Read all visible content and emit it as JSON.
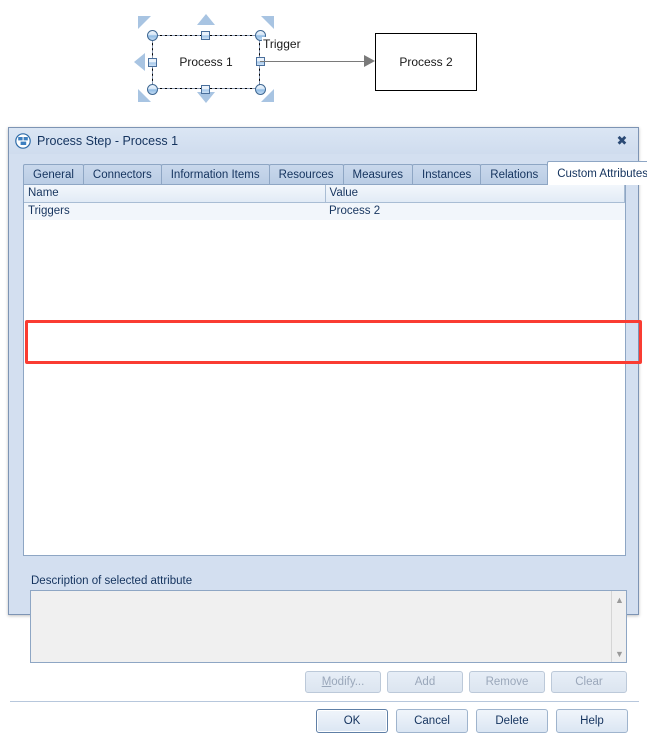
{
  "diagram": {
    "shape1_label": "Process 1",
    "shape2_label": "Process 2",
    "connector_label": "Trigger"
  },
  "dialog": {
    "title": "Process Step - Process 1",
    "icon": "process-step-icon",
    "close_label": "✖",
    "tabs": [
      {
        "label": "General",
        "active": false
      },
      {
        "label": "Connectors",
        "active": false
      },
      {
        "label": "Information Items",
        "active": false
      },
      {
        "label": "Resources",
        "active": false
      },
      {
        "label": "Measures",
        "active": false
      },
      {
        "label": "Instances",
        "active": false
      },
      {
        "label": "Relations",
        "active": false
      },
      {
        "label": "Custom Attributes",
        "active": true
      }
    ],
    "table": {
      "columns": [
        "Name",
        "Value"
      ],
      "rows": [
        {
          "name": "Triggers",
          "value": "Process 2"
        }
      ]
    },
    "description": {
      "label": "Description of selected attribute",
      "value": "",
      "scroll_up_icon": "chevron-up-icon",
      "scroll_down_icon": "chevron-down-icon"
    },
    "action_buttons": [
      {
        "label": "Modify...",
        "enabled": false
      },
      {
        "label": "Add",
        "enabled": false
      },
      {
        "label": "Remove",
        "enabled": false
      },
      {
        "label": "Clear",
        "enabled": false
      }
    ],
    "footer_buttons": [
      {
        "label": "OK",
        "default": true
      },
      {
        "label": "Cancel",
        "default": false
      },
      {
        "label": "Delete",
        "default": false
      },
      {
        "label": "Help",
        "default": false
      }
    ]
  },
  "annotation": {
    "highlight_color": "#fa3c32"
  }
}
